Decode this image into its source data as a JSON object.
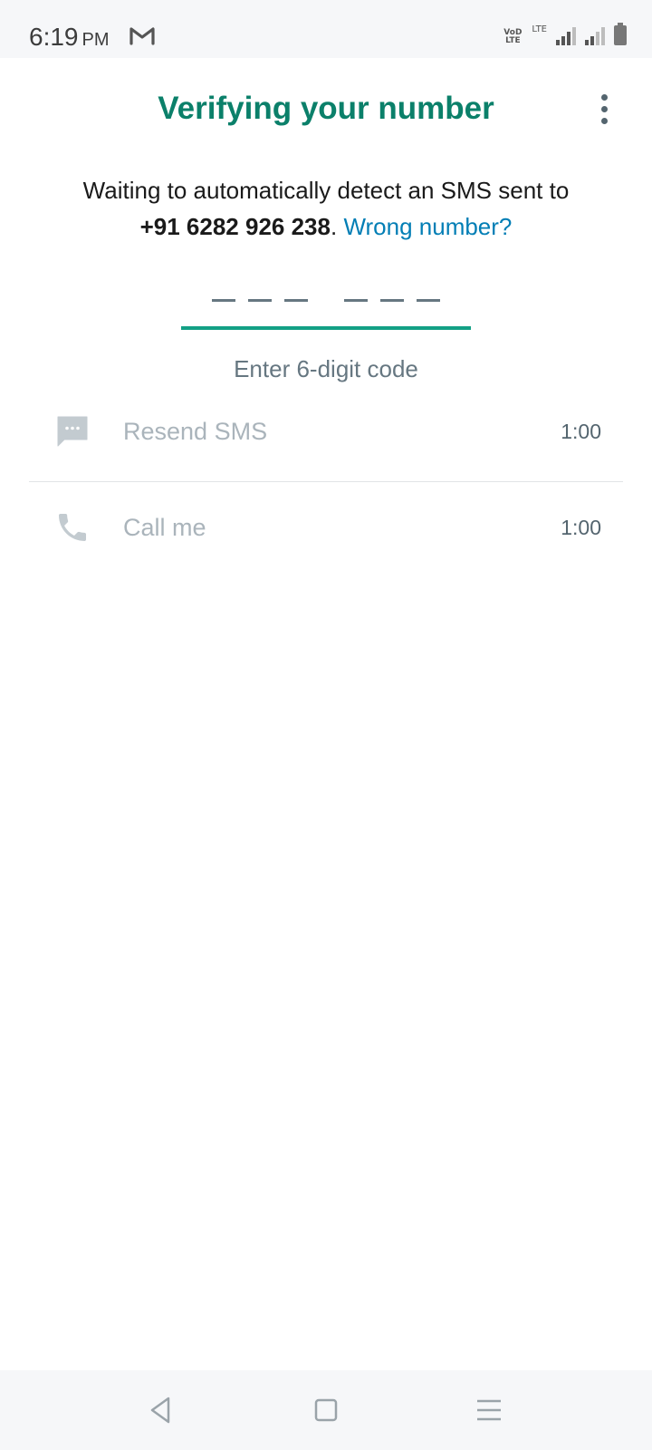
{
  "status_bar": {
    "time": "6:19",
    "ampm": "PM",
    "volte_line1": "VoD",
    "volte_line2": "LTE",
    "lte_label": "LTE",
    "icons": [
      "gmail-icon",
      "volte-icon",
      "lte-icon",
      "signal-icon",
      "battery-icon"
    ]
  },
  "header": {
    "title": "Verifying your number",
    "menu_icon": "more-vert-icon"
  },
  "description": {
    "text": "Waiting to automatically detect an SMS sent to",
    "phone_number": "+91 6282 926 238",
    "separator": ".",
    "wrong_number_link": "Wrong number?"
  },
  "code_entry": {
    "digits": 6,
    "value": "",
    "hint": "Enter 6-digit code"
  },
  "actions": [
    {
      "label": "Resend SMS",
      "timer": "1:00",
      "icon": "message-icon"
    },
    {
      "label": "Call me",
      "timer": "1:00",
      "icon": "phone-icon"
    }
  ],
  "nav_bar": {
    "icons": [
      "back-icon",
      "home-icon",
      "recents-icon"
    ]
  },
  "colors": {
    "accent": "#0b806a",
    "underline": "#13a085",
    "link": "#027eb5",
    "disabled_text": "#aab4bb",
    "secondary_text": "#667781"
  }
}
